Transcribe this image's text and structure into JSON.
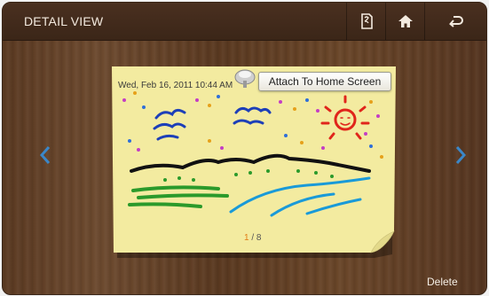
{
  "header": {
    "title": "DETAIL VIEW",
    "buttons": [
      {
        "name": "memo-icon"
      },
      {
        "name": "home-icon"
      },
      {
        "name": "back-icon"
      }
    ]
  },
  "note": {
    "date": "Wed, Feb 16, 2011 10:44 AM",
    "attach_label": "Attach To Home Screen",
    "page_current": "1",
    "page_total": "/ 8",
    "colors": {
      "paper": "#f3eba0",
      "accent_page": "#e07b14"
    }
  },
  "footer": {
    "delete_label": "Delete"
  },
  "colors": {
    "arrow": "#3b87c8",
    "header_text": "#f3eadf"
  }
}
